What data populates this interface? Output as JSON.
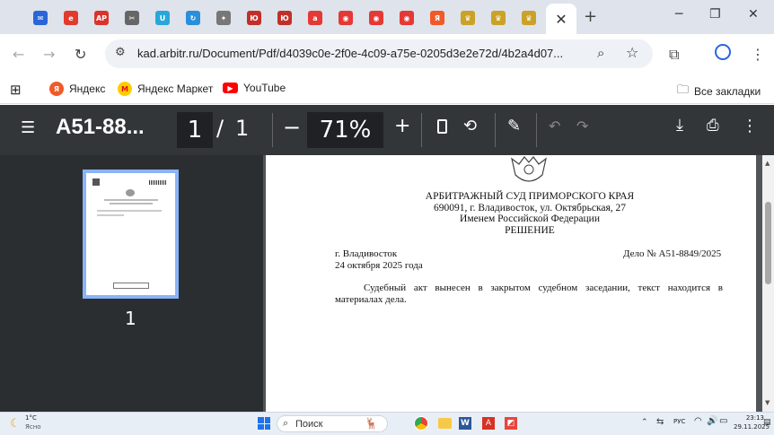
{
  "browser": {
    "tab_close_glyph": "✕",
    "new_tab_glyph": "+",
    "url": "kad.arbitr.ru/Document/Pdf/d4039c0e-2f0e-4c09-a75e-0205d3e2e72d/4b2a4d07...",
    "bookmarks": [
      "Яндекс",
      "Яндекс Маркет",
      "YouTube"
    ],
    "all_bookmarks": "Все закладки",
    "tab_favicons": [
      {
        "icon": "mail-icon",
        "color": "#2a66d9",
        "glyph": "✉"
      },
      {
        "icon": "e-icon",
        "color": "#e23b2e",
        "glyph": "е"
      },
      {
        "icon": "ap-icon",
        "color": "#d9342b",
        "glyph": "АР"
      },
      {
        "icon": "tools-icon",
        "color": "#666666",
        "glyph": "✂"
      },
      {
        "icon": "u-icon",
        "color": "#2aa7d9",
        "glyph": "U"
      },
      {
        "icon": "sync-icon",
        "color": "#2a8fd9",
        "glyph": "↻"
      },
      {
        "icon": "eagle-icon",
        "color": "#777777",
        "glyph": "✦"
      },
      {
        "icon": "court-icon",
        "color": "#c0302a",
        "glyph": "Ю"
      },
      {
        "icon": "court-icon",
        "color": "#c0302a",
        "glyph": "Ю"
      },
      {
        "icon": "a-icon",
        "color": "#e53935",
        "glyph": "a"
      },
      {
        "icon": "red-icon",
        "color": "#e53935",
        "glyph": "◉"
      },
      {
        "icon": "red-icon",
        "color": "#e53935",
        "glyph": "◉"
      },
      {
        "icon": "red-icon",
        "color": "#e53935",
        "glyph": "◉"
      },
      {
        "icon": "yandex-icon",
        "color": "#f05a28",
        "glyph": "Я"
      },
      {
        "icon": "emblem-icon",
        "color": "#c9a227",
        "glyph": "♛"
      },
      {
        "icon": "emblem-icon",
        "color": "#c9a227",
        "glyph": "♛"
      },
      {
        "icon": "emblem-icon",
        "color": "#c9a227",
        "glyph": "♛"
      }
    ]
  },
  "pdf": {
    "title": "A51-88...",
    "page_current": "1",
    "page_sep": "/",
    "page_total": "1",
    "zoom": "71%",
    "thumb_label": "1"
  },
  "document": {
    "court": "АРБИТРАЖНЫЙ СУД ПРИМОРСКОГО КРАЯ",
    "address": "690091, г. Владивосток, ул. Октябрьская, 27",
    "in_name": "Именем Российской Федерации",
    "decision": "РЕШЕНИЕ",
    "city": "г. Владивосток",
    "case": "Дело № А51-8849/2025",
    "date": "24 октября 2025 года",
    "body_line1": "Судебный акт вынесен в закрытом судебном заседании, текст находится в",
    "body_line2": "материалах дела."
  },
  "taskbar": {
    "weather_temp": "1°C",
    "weather_desc": "Ясно",
    "search": "Поиск",
    "lang": "РУС",
    "time": "23:13",
    "date": "29.11.2025"
  }
}
